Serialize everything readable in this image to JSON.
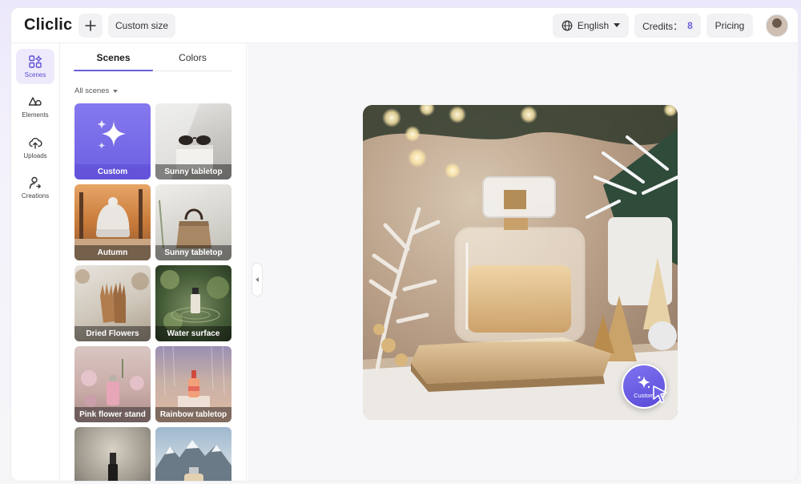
{
  "header": {
    "logo": "Cliclic",
    "plus_icon": "plus-icon",
    "custom_size_label": "Custom size",
    "language_label": "English",
    "credits_label": "Credits：",
    "credits_value": "8",
    "pricing_label": "Pricing"
  },
  "rail": {
    "items": [
      {
        "label": "Scenes",
        "icon": "grid-apps-icon"
      },
      {
        "label": "Elements",
        "icon": "shapes-icon"
      },
      {
        "label": "Uploads",
        "icon": "cloud-upload-icon"
      },
      {
        "label": "Creations",
        "icon": "user-creations-icon"
      }
    ]
  },
  "panel": {
    "tabs": [
      "Scenes",
      "Colors"
    ],
    "filter_label": "All scenes",
    "tiles": [
      {
        "label": "Custom"
      },
      {
        "label": "Sunny tabletop"
      },
      {
        "label": "Autumn"
      },
      {
        "label": "Sunny tabletop"
      },
      {
        "label": "Dried Flowers"
      },
      {
        "label": "Water surface"
      },
      {
        "label": "Pink flower stand"
      },
      {
        "label": "Rainbow tabletop"
      },
      {
        "label": ""
      },
      {
        "label": ""
      }
    ]
  },
  "canvas": {
    "badge_label": "Custom"
  },
  "colors": {
    "accent": "#6b5fd8",
    "active_rail_bg": "#eeeafc"
  }
}
